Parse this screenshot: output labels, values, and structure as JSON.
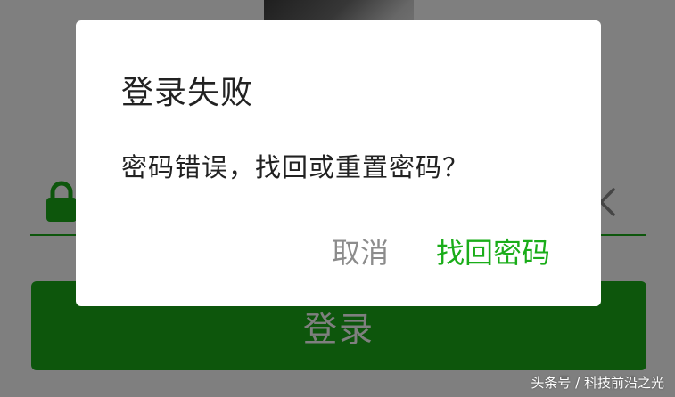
{
  "background_screen": {
    "login_button_label": "登录",
    "password_field_icon": "lock-icon",
    "clear_icon": "chevron-left-icon"
  },
  "dialog": {
    "title": "登录失败",
    "message": "密码错误，找回或重置密码？",
    "cancel_label": "取消",
    "confirm_label": "找回密码"
  },
  "watermark": {
    "text": "头条号 / 科技前沿之光"
  },
  "colors": {
    "accent": "#1aad19",
    "overlay": "rgba(0,0,0,0.5)",
    "dialog_background": "#ffffff",
    "cancel_text": "#8c8c8c"
  }
}
